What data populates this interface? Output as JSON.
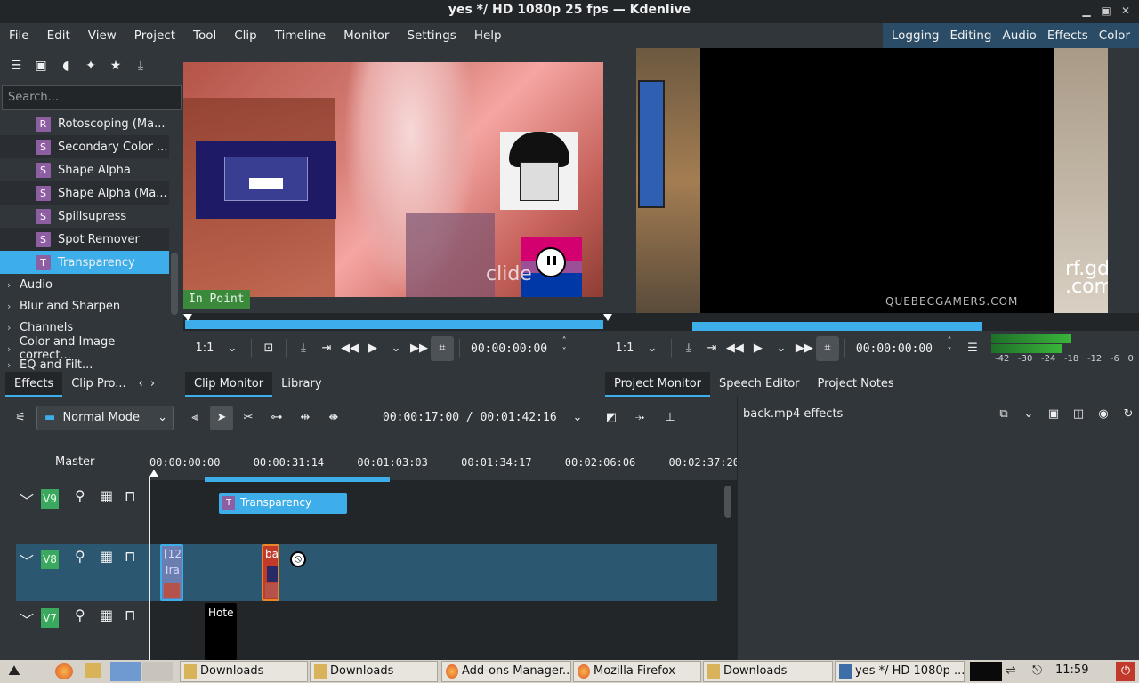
{
  "window": {
    "title": "yes */ HD 1080p 25 fps — Kdenlive"
  },
  "menubar": {
    "items": [
      "File",
      "Edit",
      "View",
      "Project",
      "Tool",
      "Clip",
      "Timeline",
      "Monitor",
      "Settings",
      "Help"
    ],
    "workspaces": [
      "Logging",
      "Editing",
      "Audio",
      "Effects",
      "Color"
    ]
  },
  "effects_panel": {
    "search_placeholder": "Search...",
    "effects": [
      {
        "badge": "R",
        "label": "Rotoscoping (Ma..."
      },
      {
        "badge": "S",
        "label": "Secondary Color ..."
      },
      {
        "badge": "S",
        "label": "Shape Alpha"
      },
      {
        "badge": "S",
        "label": "Shape Alpha (Ma..."
      },
      {
        "badge": "S",
        "label": "Spillsupress"
      },
      {
        "badge": "S",
        "label": "Spot Remover"
      },
      {
        "badge": "T",
        "label": "Transparency"
      }
    ],
    "categories": [
      "Audio",
      "Blur and Sharpen",
      "Channels",
      "Color and Image correct...",
      "EQ and Filt..."
    ],
    "tabs": [
      "Effects",
      "Clip Pro..."
    ]
  },
  "clip_monitor": {
    "in_point_label": "In Point",
    "zoom": "1:1",
    "timecode": "00:00:00:00",
    "overlay_text": "clide",
    "tabs": [
      "Clip Monitor",
      "Library"
    ]
  },
  "project_monitor": {
    "zoom": "1:1",
    "timecode": "00:00:00:00",
    "watermark": "QUEBECGAMERS.COM",
    "corner_text_1": "rf.gd",
    "corner_text_2": ".com",
    "vu_labels": [
      "-42",
      "-30",
      "-24",
      "-18",
      "-12",
      "-6",
      "0"
    ],
    "tabs": [
      "Project Monitor",
      "Speech Editor",
      "Project Notes"
    ]
  },
  "timeline": {
    "mode": "Normal Mode",
    "position": "00:00:17:00 / 00:01:42:16",
    "master_label": "Master",
    "ruler_ticks": [
      "00:00:00:00",
      "00:00:31:14",
      "00:01:03:03",
      "00:01:34:17",
      "00:02:06:06",
      "00:02:37:20"
    ],
    "tracks": [
      {
        "name": "V9"
      },
      {
        "name": "V8"
      },
      {
        "name": "V7"
      }
    ],
    "clips": {
      "transparency": "Transparency",
      "v8_clip_a_1": "[12",
      "v8_clip_a_2": "Tra",
      "v8_clip_b": "ba",
      "v7_clip": "Hote"
    }
  },
  "effect_stack": {
    "title": "back.mp4 effects"
  },
  "taskbar": {
    "tasks": [
      "Downloads",
      "Downloads",
      "Add-ons Manager...",
      "Mozilla Firefox",
      "Downloads",
      "yes */ HD 1080p ..."
    ],
    "clock": "11:59"
  }
}
